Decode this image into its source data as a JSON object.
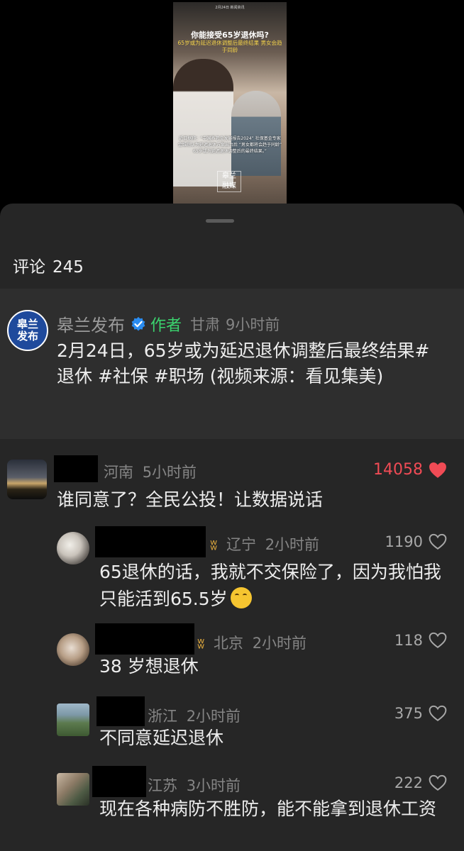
{
  "video": {
    "top_line": "2月24日 新闻资讯",
    "headline": "你能接受65岁退休吗?",
    "subline": "65岁或为延迟退休调整后最终结果 男女会趋于同龄",
    "caption": "近日据称：“中国养老金发展报告2024” 社保基金专家金维刚认为延迟退休方案出台后 “男女都将会趋于同龄” 65岁或为延迟退休调整后的最终结果。”",
    "logo_text": "皋兰 融媒"
  },
  "sheet": {
    "comments_label": "评论",
    "comments_count": "245"
  },
  "author_post": {
    "avatar_text_1": "皋兰",
    "avatar_text_2": "发布",
    "name": "皋兰发布",
    "author_tag": "作者",
    "location": "甘肃",
    "time": "9小时前",
    "text": "2月24日，65岁或为延迟退休调整后最终结果#退休 #社保 #职场 (视频来源：看见集美)"
  },
  "comments": [
    {
      "location": "河南",
      "time": "5小时前",
      "likes": "14058",
      "text": "谁同意了？全民公投！让数据说话"
    },
    {
      "badge": "ʬ",
      "location": "辽宁",
      "time": "2小时前",
      "likes": "1190",
      "text": "65退休的话，我就不交保险了，因为我怕我只能活到65.5岁"
    },
    {
      "badge": "ʬ",
      "location": "北京",
      "time": "2小时前",
      "likes": "118",
      "text": "38 岁想退休"
    },
    {
      "location": "浙江",
      "time": "2小时前",
      "likes": "375",
      "text": "不同意延迟退休"
    },
    {
      "location": "江苏",
      "time": "3小时前",
      "likes": "222",
      "text": "现在各种病防不胜防，能不能拿到退休工资"
    }
  ],
  "colors": {
    "sheet_bg": "#262626",
    "author_card_bg": "#2e2e2e",
    "author_tag": "#3bd36e",
    "hot_likes": "#f04b55",
    "verified": "#2a8cf0",
    "badge": "#d9a43c"
  },
  "icons": {
    "verified": "verified-check-icon",
    "heart_filled": "heart-filled-icon",
    "heart_outline": "heart-outline-icon",
    "emoji": "crying-laughing-emoji"
  }
}
